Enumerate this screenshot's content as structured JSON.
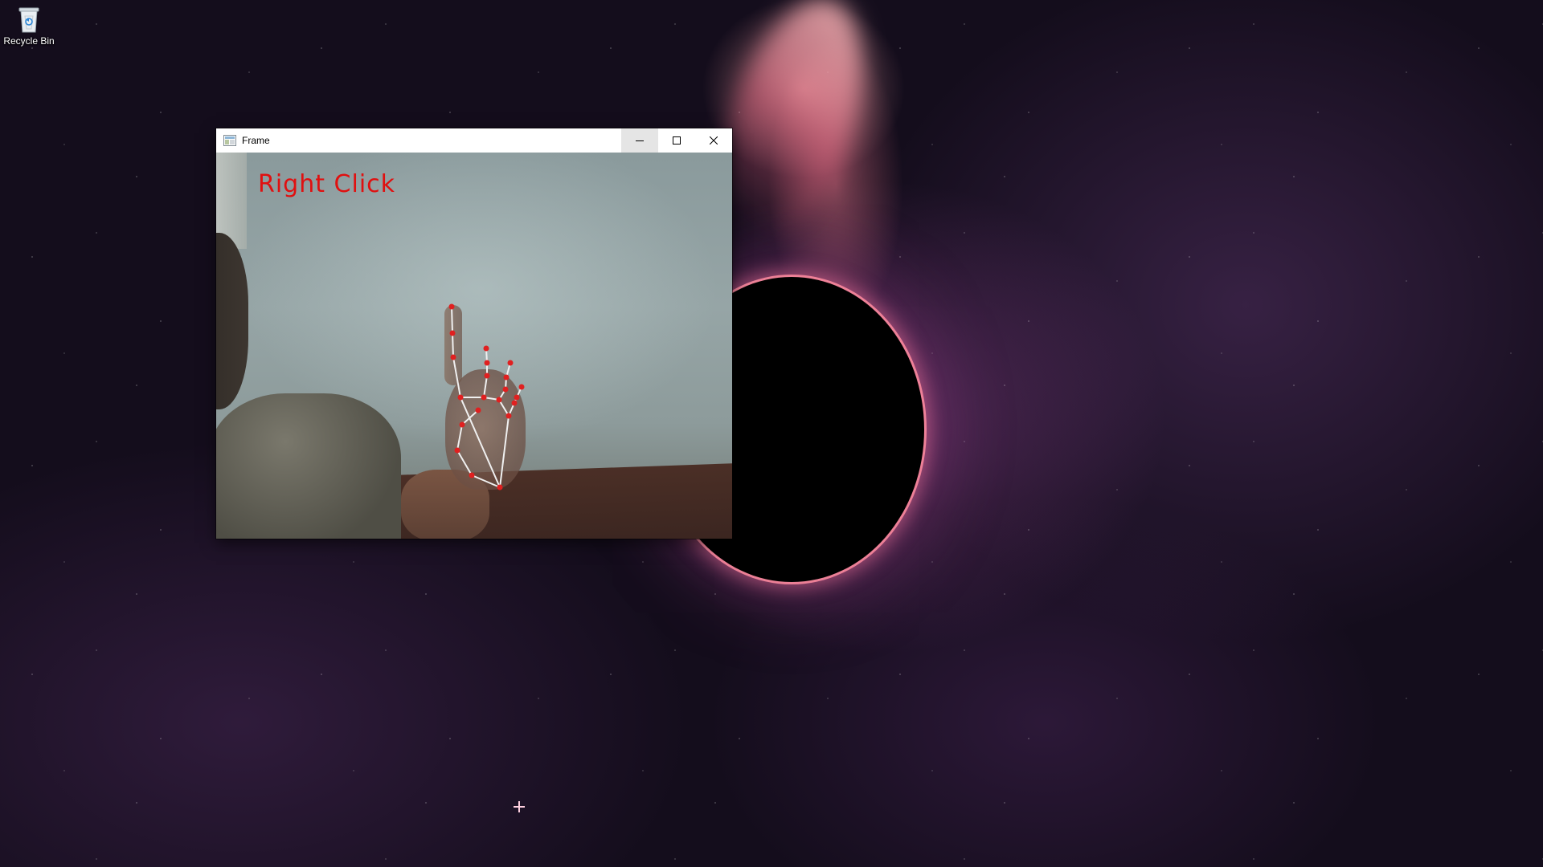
{
  "desktop": {
    "icons": [
      {
        "label": "Recycle Bin",
        "icon": "recycle-bin-icon"
      }
    ]
  },
  "window": {
    "title": "Frame",
    "icon": "opencv-window-icon",
    "controls": {
      "minimize": "minimize-icon",
      "maximize": "maximize-icon",
      "close": "close-icon"
    },
    "frame": {
      "gesture_label": "Right Click",
      "gesture_color": "#e01010",
      "landmark_color": "#e02020",
      "connection_color": "#f0f0f0"
    }
  },
  "colors": {
    "titlebar": "#ffffff",
    "wallpaper_dark": "#140d1c",
    "wallpaper_accent": "#ff8ca0"
  }
}
